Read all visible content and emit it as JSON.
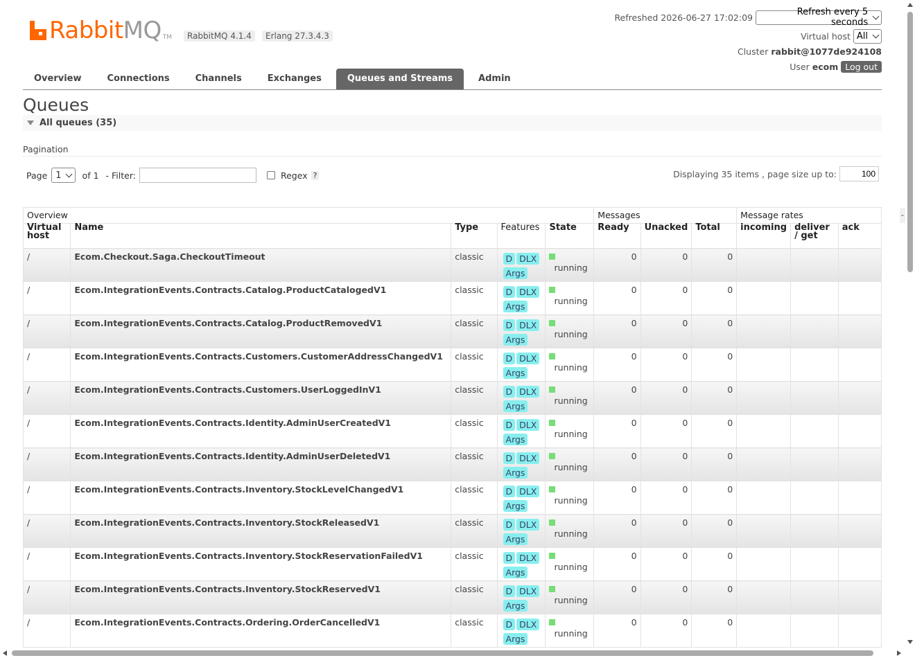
{
  "header": {
    "logo_rabbit": "Rabbit",
    "logo_mq": "MQ",
    "logo_tm": "TM",
    "version": "RabbitMQ 4.1.4",
    "erlang": "Erlang 27.3.4.3",
    "refreshed": "Refreshed 2026-06-27 17:02:09",
    "refresh_option": "Refresh every 5 seconds",
    "vhost_label": "Virtual host",
    "vhost_value": "All",
    "cluster_label": "Cluster",
    "cluster_value": "rabbit@1077de924108",
    "user_label": "User",
    "user_value": "ecom",
    "logout_label": "Log out"
  },
  "tabs": [
    "Overview",
    "Connections",
    "Channels",
    "Exchanges",
    "Queues and Streams",
    "Admin"
  ],
  "active_tab": "Queues and Streams",
  "page_title": "Queues",
  "section_label": "All queues (35)",
  "pagination": {
    "label": "Pagination",
    "page_label": "Page",
    "page_value": "1",
    "of_label": "of 1",
    "filter_label": "- Filter:",
    "regex_label": "Regex",
    "help_label": "?",
    "display_text": "Displaying 35 items , page size up to:",
    "page_size": "100"
  },
  "table": {
    "groups": [
      "Overview",
      "Messages",
      "Message rates"
    ],
    "columns": [
      "Virtual host",
      "Name",
      "Type",
      "Features",
      "State",
      "Ready",
      "Unacked",
      "Total",
      "incoming",
      "deliver / get",
      "ack"
    ],
    "feature_badges": [
      "D",
      "DLX",
      "Args"
    ],
    "rows": [
      {
        "vhost": "/",
        "name": "Ecom.Checkout.Saga.CheckoutTimeout",
        "type": "classic",
        "state": "running",
        "ready": "0",
        "unacked": "0",
        "total": "0"
      },
      {
        "vhost": "/",
        "name": "Ecom.IntegrationEvents.Contracts.Catalog.ProductCatalogedV1",
        "type": "classic",
        "state": "running",
        "ready": "0",
        "unacked": "0",
        "total": "0"
      },
      {
        "vhost": "/",
        "name": "Ecom.IntegrationEvents.Contracts.Catalog.ProductRemovedV1",
        "type": "classic",
        "state": "running",
        "ready": "0",
        "unacked": "0",
        "total": "0"
      },
      {
        "vhost": "/",
        "name": "Ecom.IntegrationEvents.Contracts.Customers.CustomerAddressChangedV1",
        "type": "classic",
        "state": "running",
        "ready": "0",
        "unacked": "0",
        "total": "0"
      },
      {
        "vhost": "/",
        "name": "Ecom.IntegrationEvents.Contracts.Customers.UserLoggedInV1",
        "type": "classic",
        "state": "running",
        "ready": "0",
        "unacked": "0",
        "total": "0"
      },
      {
        "vhost": "/",
        "name": "Ecom.IntegrationEvents.Contracts.Identity.AdminUserCreatedV1",
        "type": "classic",
        "state": "running",
        "ready": "0",
        "unacked": "0",
        "total": "0"
      },
      {
        "vhost": "/",
        "name": "Ecom.IntegrationEvents.Contracts.Identity.AdminUserDeletedV1",
        "type": "classic",
        "state": "running",
        "ready": "0",
        "unacked": "0",
        "total": "0"
      },
      {
        "vhost": "/",
        "name": "Ecom.IntegrationEvents.Contracts.Inventory.StockLevelChangedV1",
        "type": "classic",
        "state": "running",
        "ready": "0",
        "unacked": "0",
        "total": "0"
      },
      {
        "vhost": "/",
        "name": "Ecom.IntegrationEvents.Contracts.Inventory.StockReleasedV1",
        "type": "classic",
        "state": "running",
        "ready": "0",
        "unacked": "0",
        "total": "0"
      },
      {
        "vhost": "/",
        "name": "Ecom.IntegrationEvents.Contracts.Inventory.StockReservationFailedV1",
        "type": "classic",
        "state": "running",
        "ready": "0",
        "unacked": "0",
        "total": "0"
      },
      {
        "vhost": "/",
        "name": "Ecom.IntegrationEvents.Contracts.Inventory.StockReservedV1",
        "type": "classic",
        "state": "running",
        "ready": "0",
        "unacked": "0",
        "total": "0"
      },
      {
        "vhost": "/",
        "name": "Ecom.IntegrationEvents.Contracts.Ordering.OrderCancelledV1",
        "type": "classic",
        "state": "running",
        "ready": "0",
        "unacked": "0",
        "total": "0"
      }
    ]
  },
  "colors": {
    "brand": "#ff6600",
    "tab_active": "#666666",
    "badge": "#88eeee",
    "state_running": "#77dd77"
  },
  "edge_marker": "-"
}
